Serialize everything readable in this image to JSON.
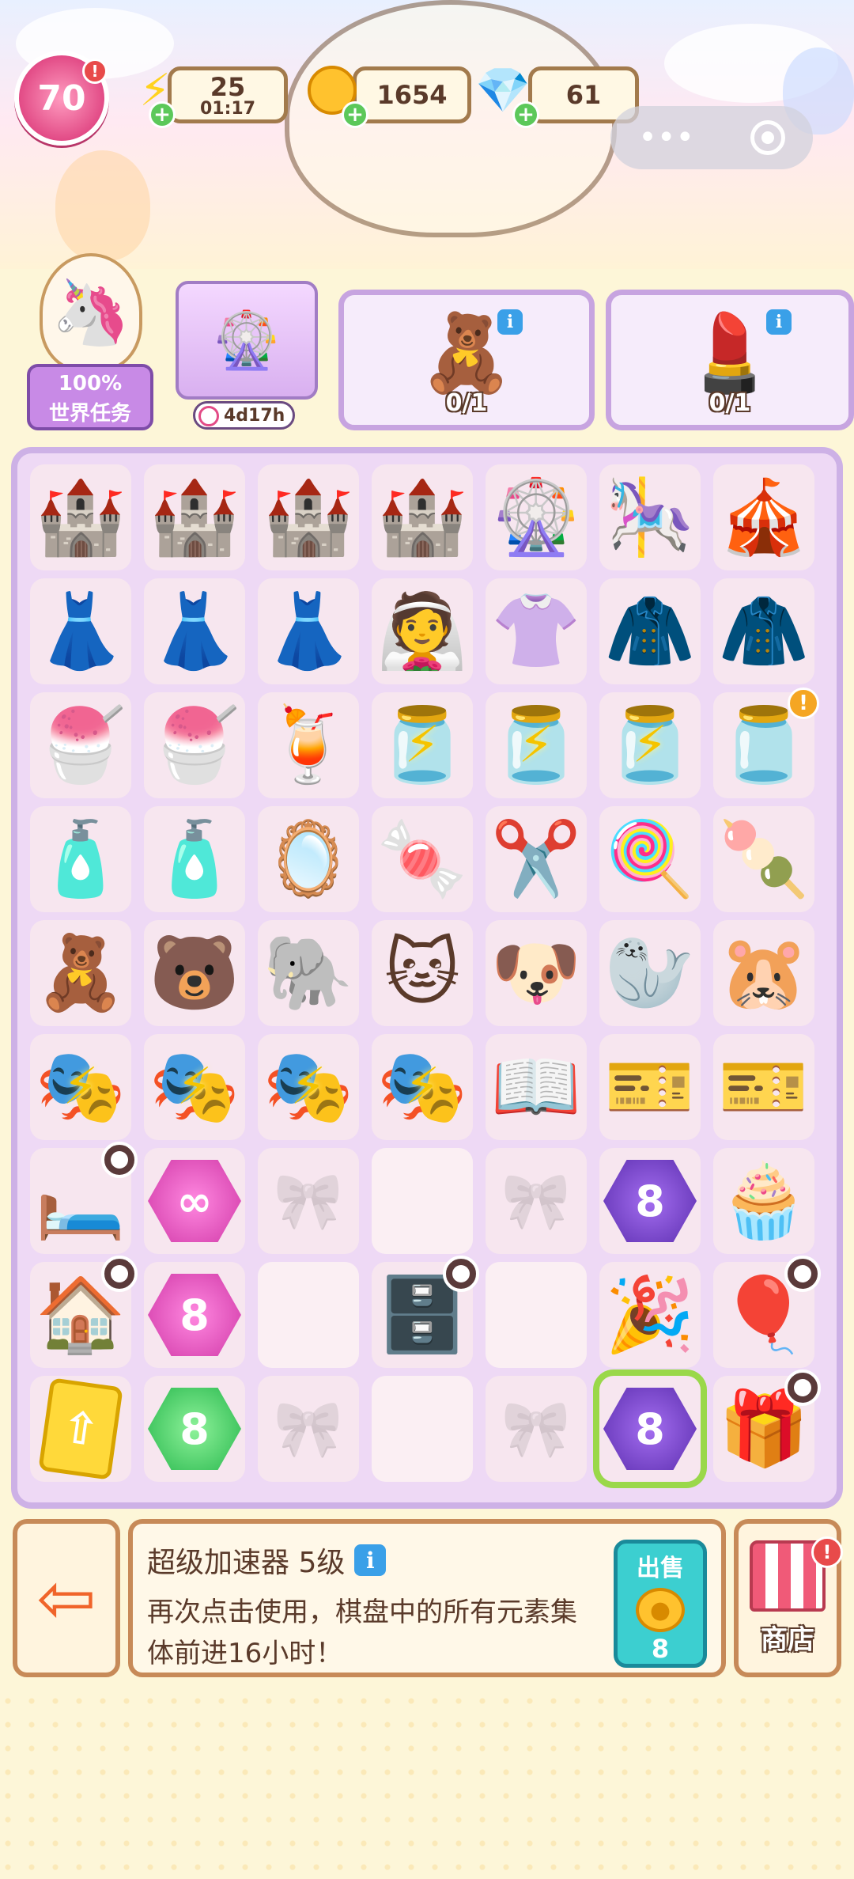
{
  "hud": {
    "level": "70",
    "level_notif": "!",
    "energy": {
      "value": "25",
      "timer": "01:17",
      "icon": "lightning-icon"
    },
    "coins": {
      "value": "1654",
      "icon": "coin-icon"
    },
    "gems": {
      "value": "61",
      "icon": "gem-icon"
    },
    "plus": "+",
    "menu_dots": "•••"
  },
  "tasks": {
    "world_task": {
      "progress": "100%",
      "label": "世界任务"
    },
    "event": {
      "timer": "4d17h"
    },
    "orders": [
      {
        "item": "🧸",
        "count": "0/1",
        "info": "i"
      },
      {
        "item": "💄",
        "count": "0/1",
        "info": "i"
      }
    ]
  },
  "board": {
    "rows": [
      [
        {
          "e": "🏰"
        },
        {
          "e": "🏰"
        },
        {
          "e": "🏰"
        },
        {
          "e": "🏰"
        },
        {
          "e": "🎡"
        },
        {
          "e": "🎠"
        },
        {
          "e": "🎪"
        }
      ],
      [
        {
          "e": "👗"
        },
        {
          "e": "👗"
        },
        {
          "e": "👗"
        },
        {
          "e": "👰"
        },
        {
          "e": "👚"
        },
        {
          "e": "🧥"
        },
        {
          "e": "🧥"
        }
      ],
      [
        {
          "e": "🍧"
        },
        {
          "e": "🍧"
        },
        {
          "e": "🍹"
        },
        {
          "e": "🫙",
          "bolt": true
        },
        {
          "e": "🫙",
          "bolt": true
        },
        {
          "e": "🫙",
          "bolt": true
        },
        {
          "e": "🫙",
          "alert": true
        }
      ],
      [
        {
          "e": "🧴"
        },
        {
          "e": "🧴"
        },
        {
          "e": "🪞"
        },
        {
          "e": "🍬"
        },
        {
          "e": "✂️"
        },
        {
          "e": "🍭"
        },
        {
          "e": "🍡"
        }
      ],
      [
        {
          "e": "🧸"
        },
        {
          "e": "🐻"
        },
        {
          "e": "🐘"
        },
        {
          "e": "🐱"
        },
        {
          "e": "🐶"
        },
        {
          "e": "🦭"
        },
        {
          "e": "🐹"
        }
      ],
      [
        {
          "e": "🎭",
          "bolt": true
        },
        {
          "e": "🎭",
          "bolt": true
        },
        {
          "e": "🎭",
          "bolt": true
        },
        {
          "e": "🎭",
          "bolt": true
        },
        {
          "e": "📖"
        },
        {
          "e": "🎫"
        },
        {
          "e": "🎫"
        }
      ],
      [
        {
          "e": "🛏️",
          "clock": true
        },
        {
          "hex": "pink",
          "sym": "∞"
        },
        {
          "bow": true
        },
        {
          "empty": true
        },
        {
          "bow": true
        },
        {
          "hex": "purple",
          "sym": "8"
        },
        {
          "e": "🧁"
        }
      ],
      [
        {
          "e": "🏠",
          "clock": true
        },
        {
          "hex": "pink",
          "sym": "8"
        },
        {
          "empty": true
        },
        {
          "e": "🗄️",
          "clock": true
        },
        {
          "empty": true
        },
        {
          "e": "🎉"
        },
        {
          "e": "🎈",
          "clock": true
        }
      ],
      [
        {
          "up": true,
          "sym": "⇧"
        },
        {
          "hex": "green",
          "sym": "8"
        },
        {
          "bow": true
        },
        {
          "empty": true
        },
        {
          "bow": true
        },
        {
          "hex": "purple",
          "sym": "8",
          "selected": true
        },
        {
          "e": "🎁",
          "clock": true
        }
      ]
    ]
  },
  "info_panel": {
    "title": "超级加速器 5级",
    "info": "i",
    "description": "再次点击使用，棋盘中的所有元素集体前进16小时！",
    "sell_label": "出售",
    "sell_price": "8"
  },
  "shop": {
    "label": "商店",
    "notif": "!"
  },
  "colors": {
    "board_border": "#cdb1e6",
    "panel_border": "#c78a58",
    "sell_button": "#3ccfd0",
    "level_badge": "#e24b86"
  }
}
